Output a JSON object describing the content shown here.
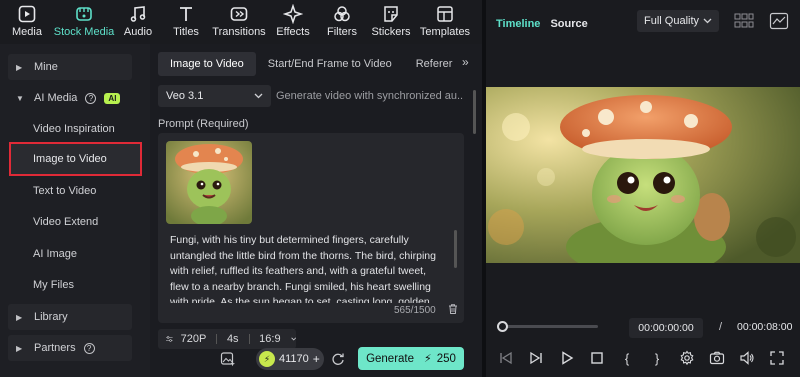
{
  "toolbar": {
    "items": [
      {
        "label": "Media",
        "icon": "media-icon"
      },
      {
        "label": "Stock Media",
        "icon": "stock-media-icon"
      },
      {
        "label": "Audio",
        "icon": "music-note-icon"
      },
      {
        "label": "Titles",
        "icon": "text-t-icon"
      },
      {
        "label": "Transitions",
        "icon": "transitions-icon"
      },
      {
        "label": "Effects",
        "icon": "sparkle-icon"
      },
      {
        "label": "Filters",
        "icon": "filters-icon"
      },
      {
        "label": "Stickers",
        "icon": "sticker-icon"
      },
      {
        "label": "Templates",
        "icon": "templates-icon"
      }
    ],
    "active_index": 1
  },
  "sidebar": {
    "groups": {
      "mine": "Mine",
      "ai_media": "AI Media",
      "ai_badge": "AI",
      "library": "Library",
      "partners": "Partners"
    },
    "ai_items": {
      "video_inspiration": "Video Inspiration",
      "image_to_video": "Image to Video",
      "text_to_video": "Text to Video",
      "video_extend": "Video Extend",
      "ai_image": "AI Image",
      "my_files": "My Files"
    },
    "help_glyph": "?"
  },
  "panel": {
    "tabs": {
      "image_to_video": "Image to Video",
      "start_end": "Start/End Frame to Video",
      "reference": "Referer"
    },
    "tab_more_glyph": "»",
    "model": "Veo 3.1",
    "model_description": "Generate video with synchronized au...",
    "prompt_label": "Prompt (Required)",
    "prompt_text": "Fungi, with his tiny but determined fingers, carefully untangled the little bird from the thorns. The bird, chirping with relief, ruffled its feathers and, with a grateful tweet, flew to a nearby branch. Fungi smiled, his heart swelling with pride. As the sun began to set, casting long, golden",
    "char_counter": "565/1500",
    "settings": {
      "resolution": "720P",
      "duration": "4s",
      "ratio": "16:9"
    },
    "credits": "41170",
    "generate_label": "Generate",
    "generate_cost": "250"
  },
  "player": {
    "tab_timeline": "Timeline",
    "tab_source": "Source",
    "quality": "Full Quality",
    "current_time": "00:00:00:00",
    "separator": "/",
    "total_time": "00:00:08:00",
    "playhead_progress": 0
  },
  "colors": {
    "accent": "#5ee0c9",
    "generate_bg": "#6ee6c9",
    "ai_badge": "#b7f04f",
    "highlight_border": "#e02a37"
  }
}
